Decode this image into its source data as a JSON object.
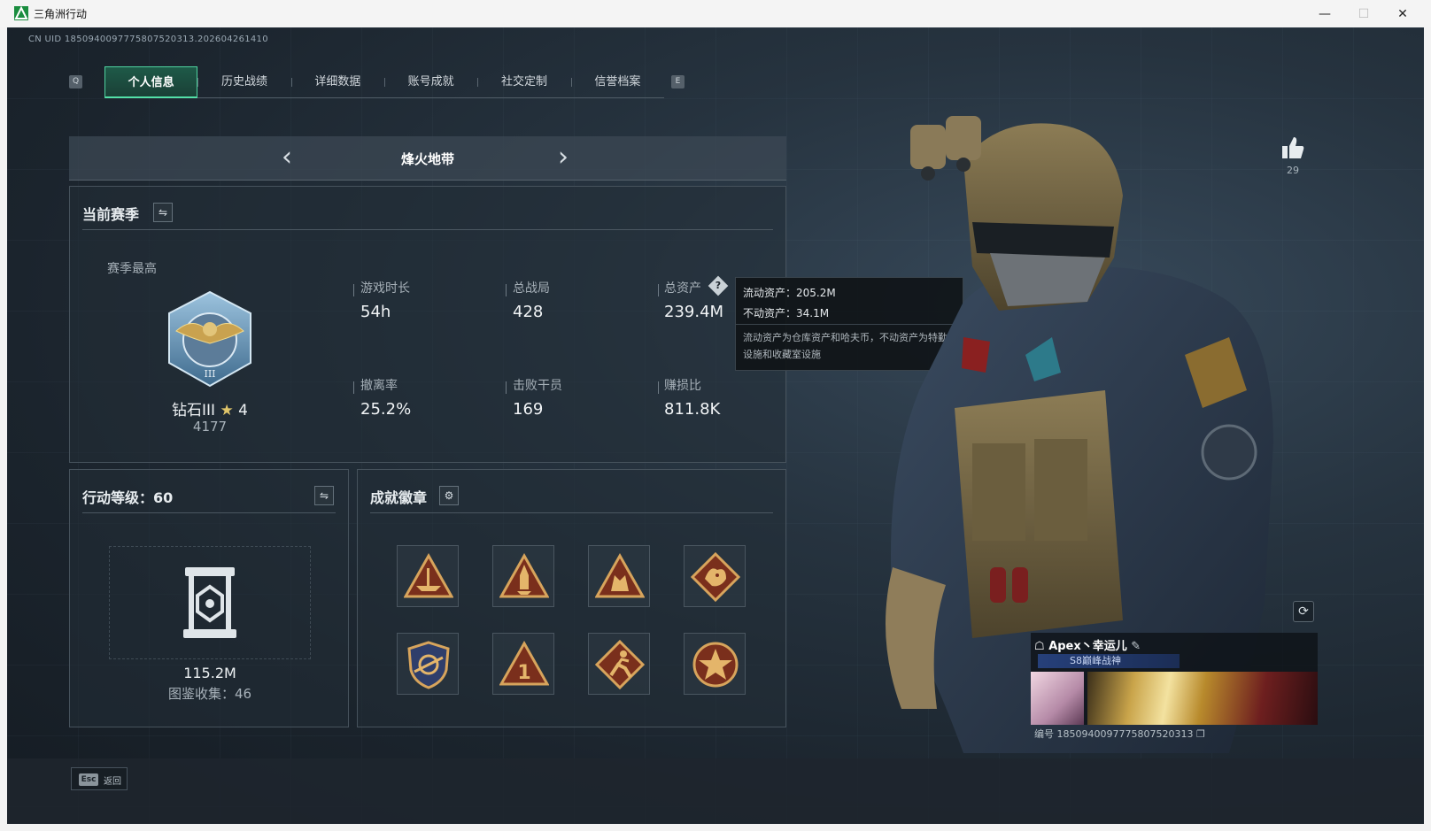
{
  "window": {
    "title": "三角洲行动",
    "controls": {
      "minimize": "—",
      "maximize": "☐",
      "close": "✕"
    }
  },
  "uid_line": "CN UID 1850940097775807520313.202604261410",
  "tabs": {
    "key_left": "Q",
    "key_right": "E",
    "items": [
      {
        "label": "个人信息",
        "active": true
      },
      {
        "label": "历史战绩",
        "active": false
      },
      {
        "label": "详细数据",
        "active": false
      },
      {
        "label": "账号成就",
        "active": false
      },
      {
        "label": "社交定制",
        "active": false
      },
      {
        "label": "信誉档案",
        "active": false
      }
    ]
  },
  "mode_selector": {
    "current": "烽火地带",
    "prev_icon": "chevron-left-icon",
    "next_icon": "chevron-right-icon"
  },
  "season": {
    "title": "当前赛季",
    "best_label": "赛季最高",
    "rank": "钻石III",
    "stars": "4",
    "score": "4177",
    "stats": [
      {
        "label": "游戏时长",
        "value": "54h"
      },
      {
        "label": "总战局",
        "value": "428"
      },
      {
        "label": "总资产",
        "value": "239.4M",
        "help": "?"
      },
      {
        "label": "撤离率",
        "value": "25.2%"
      },
      {
        "label": "击败干员",
        "value": "169"
      },
      {
        "label": "赚损比",
        "value": "811.8K"
      }
    ]
  },
  "tooltip": {
    "liquid": "流动资产：205.2M",
    "fixed": "不动资产：34.1M",
    "note": "流动资产为仓库资产和哈夫币，不动资产为特勤处设施和收藏室设施"
  },
  "level": {
    "title": "行动等级：60",
    "value": "115.2M",
    "collection": "图鉴收集：46"
  },
  "achievements": {
    "title": "成就徽章",
    "badges": [
      "ship-badge-icon",
      "rocket-badge-icon",
      "wolf-badge-icon",
      "dragon-badge-icon",
      "shield-badge-icon",
      "number-one-badge-icon",
      "runner-badge-icon",
      "star-badge-icon"
    ]
  },
  "profile": {
    "likes": "29",
    "player_name": "Apex丶幸运儿",
    "title_badge": "S8巅峰战神",
    "id_line": "编号 1850940097775807520313"
  },
  "bottom": {
    "esc_key": "Esc",
    "back_label": "返回"
  },
  "colors": {
    "accent": "#4fd3a0",
    "panel_border": "#46525c",
    "background": "#1b242d"
  }
}
